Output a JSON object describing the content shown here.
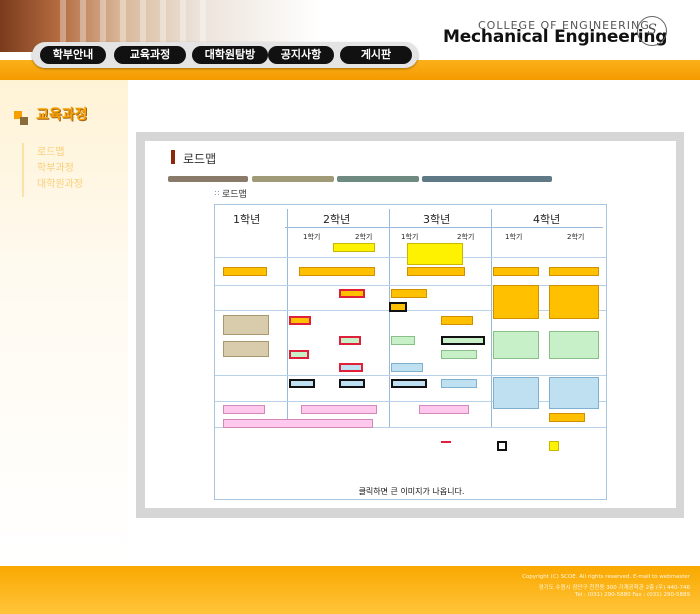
{
  "header": {
    "logo_sub": "COLLEGE OF ENGINEERING",
    "logo_main": "Mechanical Engineering",
    "logo_seal": "S",
    "nav": [
      "학부안내",
      "교육과정",
      "대학원탐방",
      "공지사항",
      "게시판"
    ]
  },
  "sidebar": {
    "title": "교육과정",
    "items": [
      "로드맵",
      "학부과정",
      "대학원과정"
    ]
  },
  "content": {
    "page_title": "로드맵",
    "sub_title": "로드맵",
    "caption": "클릭하면 큰 이미지가 나옵니다."
  },
  "roadmap": {
    "years": [
      "1학년",
      "2학년",
      "3학년",
      "4학년"
    ],
    "semesters": [
      "1학기",
      "2학기",
      "1학기",
      "2학기",
      "1학기",
      "2학기"
    ]
  },
  "colors": {
    "accent_orange": "#f5a000",
    "divider_1": "#8a7a6a",
    "divider_2": "#a09a78",
    "divider_3": "#6f8a80",
    "divider_4": "#5f7a86"
  },
  "footer": {
    "line1": "Copyright (C) SCOE. All rights reserved. E-mail to webmaster",
    "line2": "경기도 수원시 장안구 천천동 300 기계공학관 2층 (우) 440-746",
    "line3": "Tel : (031) 290-5880  Fax : (031) 290-5889"
  }
}
